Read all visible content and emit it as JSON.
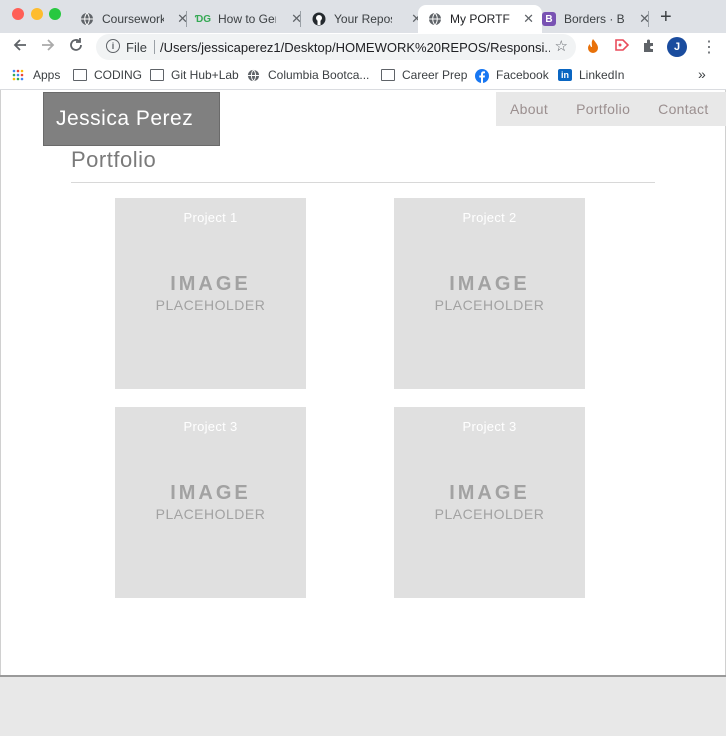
{
  "browser": {
    "tabs": [
      {
        "title": "Coursework",
        "favicon": "globe-icon"
      },
      {
        "title": "How to Gen",
        "favicon": "dg-icon"
      },
      {
        "title": "Your Reposi",
        "favicon": "github-icon"
      },
      {
        "title": "My PORTFO",
        "favicon": "globe-icon",
        "active": true
      },
      {
        "title": "Borders · Bo",
        "favicon": "bootstrap-icon"
      }
    ],
    "new_tab": "+",
    "close_glyph": "✕",
    "address": {
      "scheme_label": "File",
      "url": "/Users/jessicaperez1/Desktop/HOMEWORK%20REPOS/Responsi..."
    },
    "profile_initial": "J",
    "bookmarks": [
      {
        "label": "Apps",
        "icon": "apps-grid-icon"
      },
      {
        "label": "CODING",
        "icon": "folder-icon"
      },
      {
        "label": "Git Hub+Lab",
        "icon": "folder-icon"
      },
      {
        "label": "Columbia Bootca...",
        "icon": "globe-icon"
      },
      {
        "label": "Career Prep",
        "icon": "folder-icon"
      },
      {
        "label": "Facebook",
        "icon": "facebook-icon"
      },
      {
        "label": "LinkedIn",
        "icon": "linkedin-icon"
      }
    ],
    "bookmarks_overflow": "»"
  },
  "site": {
    "brand": "Jessica Perez",
    "nav": [
      "About",
      "Portfolio",
      "Contact"
    ],
    "section_title": "Portfolio",
    "projects": [
      {
        "title": "Project 1",
        "image_line1": "IMAGE",
        "image_line2": "PLACEHOLDER"
      },
      {
        "title": "Project 2",
        "image_line1": "IMAGE",
        "image_line2": "PLACEHOLDER"
      },
      {
        "title": "Project 3",
        "image_line1": "IMAGE",
        "image_line2": "PLACEHOLDER"
      },
      {
        "title": "Project 3",
        "image_line1": "IMAGE",
        "image_line2": "PLACEHOLDER"
      }
    ]
  },
  "colors": {
    "brand_bg": "#808080",
    "nav_text": "#9b8f8f",
    "card_bg": "#e0e0e0",
    "footer_bg": "#e8e8e8"
  }
}
